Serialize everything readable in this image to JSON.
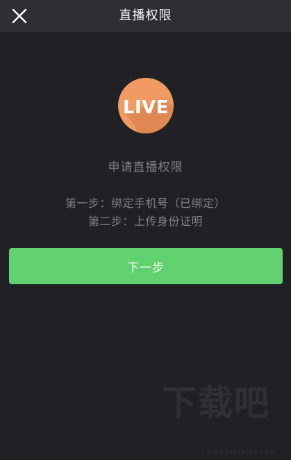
{
  "nav": {
    "title": "直播权限",
    "close_icon": "close-icon"
  },
  "badge": {
    "text": "LIVE",
    "icon": "live-badge-icon",
    "color": "#f09b63"
  },
  "content": {
    "title": "申请直播权限",
    "steps": [
      "第一步：绑定手机号（已绑定）",
      "第二步：上传身份证明"
    ]
  },
  "next_button": {
    "label": "下一步",
    "color": "#62d16f"
  },
  "watermark": {
    "text": "下载吧",
    "url": "www.xiazaiba.com"
  }
}
